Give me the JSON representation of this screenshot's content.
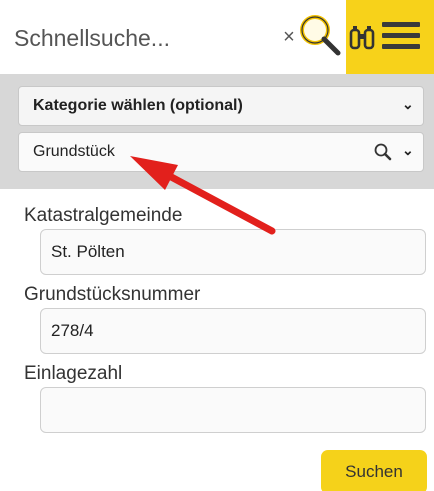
{
  "search": {
    "placeholder": "Schnellsuche...",
    "clear_symbol": "×"
  },
  "icons": {
    "clear": "close-icon",
    "search": "magnifier-icon",
    "binoculars": "binoculars-icon",
    "menu": "hamburger-menu-icon",
    "chevron": "chevron-down-icon",
    "arrow": "red-arrow-annotation"
  },
  "filters": {
    "category_label": "Kategorie wählen (optional)",
    "type_value": "Grundstück"
  },
  "form": {
    "katastralgemeinde_label": "Katastralgemeinde",
    "katastralgemeinde_value": "St. Pölten",
    "grundstuecksnummer_label": "Grundstücksnummer",
    "grundstuecksnummer_value": "278/4",
    "einlagezahl_label": "Einlagezahl",
    "einlagezahl_value": "",
    "submit_label": "Suchen"
  },
  "colors": {
    "accent_yellow": "#f7d21a",
    "band_grey": "#d7d7d7",
    "annotation_red": "#e2201c"
  }
}
